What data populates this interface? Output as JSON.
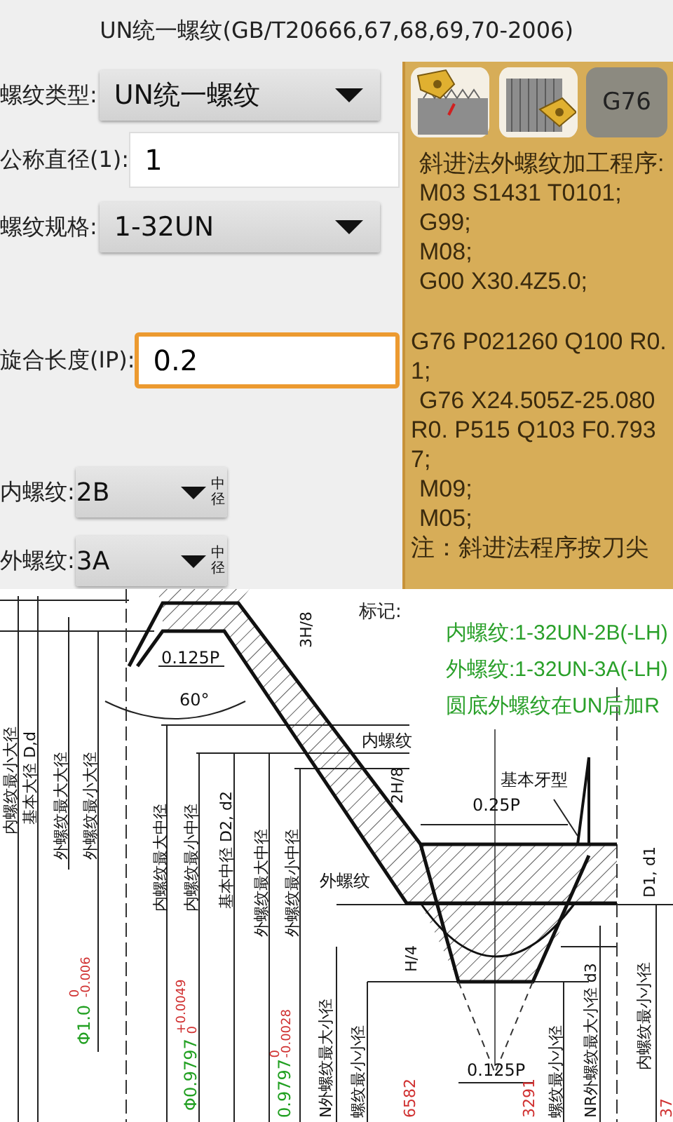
{
  "title": "UN统一螺纹(GB/T20666,67,68,69,70-2006)",
  "form": {
    "thread_type": {
      "label": "螺纹类型:",
      "value": "UN统一螺纹"
    },
    "nominal_diameter": {
      "label": "公称直径(1):",
      "value": "1"
    },
    "thread_spec": {
      "label": "螺纹规格:",
      "value": "1-32UN"
    },
    "engagement_length": {
      "label": "旋合长度(IP):",
      "value": "0.2",
      "focused": true
    },
    "classes": [
      {
        "label": "内螺纹:",
        "value": "2B",
        "tag": "中径"
      },
      {
        "label": "外螺纹:",
        "value": "3A",
        "tag": "中径"
      }
    ]
  },
  "side_panel": {
    "tool_buttons": [
      {
        "kind": "internal_tool"
      },
      {
        "kind": "external_tool"
      },
      {
        "kind": "code",
        "label": "G76"
      }
    ],
    "program": [
      {
        "text": "斜进法外螺纹加工程序:",
        "indent": true,
        "gap_before": false
      },
      {
        "text": "M03 S1431 T0101;",
        "indent": true,
        "gap_before": false
      },
      {
        "text": "G99;",
        "indent": true,
        "gap_before": false
      },
      {
        "text": "M08;",
        "indent": true,
        "gap_before": false
      },
      {
        "text": "G00 X30.4Z5.0;",
        "indent": true,
        "gap_before": false
      },
      {
        "text": "G76 P021260 Q100 R0.1;",
        "indent": false,
        "gap_before": true
      },
      {
        "text": "G76 X24.505Z-25.080 R0. P515 Q103 F0.7937;",
        "indent": true,
        "gap_before": false
      },
      {
        "text": "M09;",
        "indent": true,
        "gap_before": false
      },
      {
        "text": "M05;",
        "indent": true,
        "gap_before": false
      },
      {
        "text": "注：斜进法程序按刀尖",
        "indent": false,
        "gap_before": false
      }
    ]
  },
  "drawing": {
    "marking": {
      "title": "标记:",
      "lines": [
        "内螺纹:1-32UN-2B(-LH)",
        "外螺纹:1-32UN-3A(-LH)",
        "圆底外螺纹在UN后加R"
      ]
    },
    "labels": [
      "内螺纹最小大径",
      "基本大径 D,d",
      "外螺纹最大大径",
      "外螺纹最小大径",
      "内螺纹最大中径",
      "内螺纹最小中径",
      "基本中径 D2, d2",
      "外螺纹最大中径",
      "外螺纹最小中径",
      "N外螺纹最大小径",
      "螺纹最小小径",
      "螺纹最小小径",
      "NR外螺纹最大小径 d3",
      "内螺纹最小小径",
      "D1, d1",
      "3H/8",
      "2H/8",
      "H/4",
      "0.125P",
      "60°",
      "内螺纹",
      "外螺纹",
      "基本牙型",
      "0.25P",
      "0.125P"
    ],
    "tolerances": [
      {
        "value": "Φ1.0",
        "upper": "0",
        "lower": "-0.006"
      },
      {
        "value": "Φ0.9797",
        "upper": "+0.0049",
        "lower": "0"
      },
      {
        "value": "0.9797",
        "upper": "0",
        "lower": "-0.0028"
      }
    ],
    "red_values": [
      "6582",
      "3291",
      "37"
    ]
  }
}
